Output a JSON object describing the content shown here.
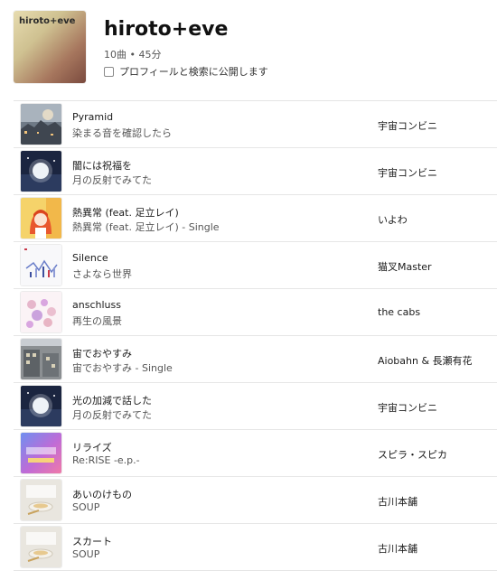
{
  "playlist": {
    "cover_text": "hiroto+eve",
    "title": "hiroto+eve",
    "meta": "10曲 • 45分",
    "share_label": "プロフィールと検索に公開します",
    "share_checked": false
  },
  "tracks": [
    {
      "title": "Pyramid",
      "album": "染まる音を確認したら",
      "artist": "宇宙コンビニ",
      "art_icon": "album-art-night-city"
    },
    {
      "title": "闇には祝福を",
      "album": "月の反射でみてた",
      "artist": "宇宙コンビニ",
      "art_icon": "album-art-moon"
    },
    {
      "title": "熱異常 (feat. 足立レイ)",
      "album": "熱異常 (feat. 足立レイ) - Single",
      "artist": "いよわ",
      "art_icon": "album-art-anime-girl"
    },
    {
      "title": "Silence",
      "album": "さよなら世界",
      "artist": "猫叉Master",
      "art_icon": "album-art-scatter"
    },
    {
      "title": "anschluss",
      "album": "再生の風景",
      "artist": "the cabs",
      "art_icon": "album-art-pink-pattern"
    },
    {
      "title": "宙でおやすみ",
      "album": "宙でおやすみ - Single",
      "artist": "Aiobahn & 長瀬有花",
      "art_icon": "album-art-building"
    },
    {
      "title": "光の加減で話した",
      "album": "月の反射でみてた",
      "artist": "宇宙コンビニ",
      "art_icon": "album-art-moon"
    },
    {
      "title": "リライズ",
      "album": "Re:RISE -e.p.-",
      "artist": "スピラ・スピカ",
      "art_icon": "album-art-blue-pink"
    },
    {
      "title": "あいのけもの",
      "album": "SOUP",
      "artist": "古川本舗",
      "art_icon": "album-art-soup"
    },
    {
      "title": "スカート",
      "album": "SOUP",
      "artist": "古川本舗",
      "art_icon": "album-art-soup"
    }
  ]
}
